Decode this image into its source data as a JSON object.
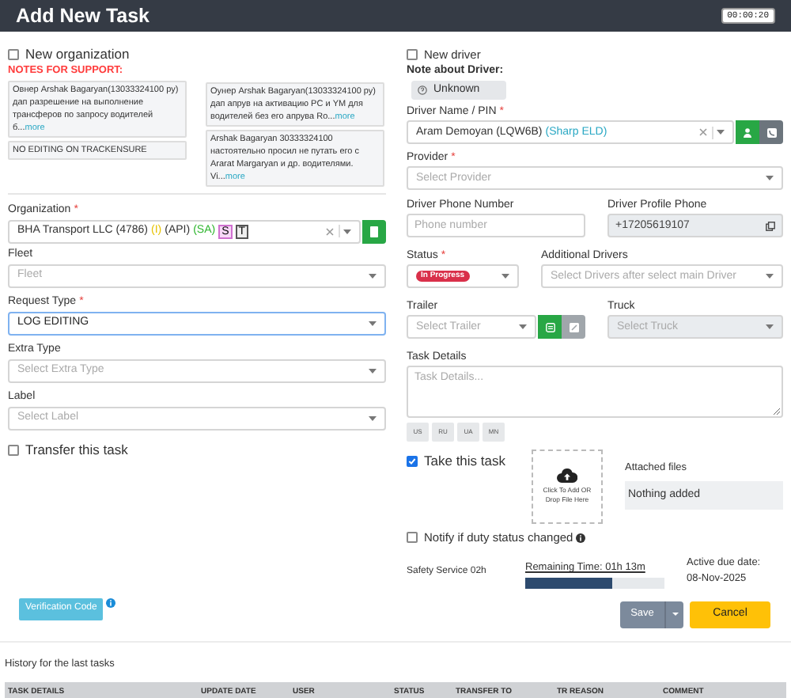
{
  "window": {
    "title": "Add New Task",
    "timer": "00:00:20"
  },
  "new_organization": {
    "label": "New organization",
    "checked": false
  },
  "notes": {
    "title": "NOTES FOR SUPPORT:",
    "columns": [
      [
        {
          "text": "Овнер Arshak Bagaryan(13033324100 ру) дап разрешение на выполнение трансферов по запросу водителей б...",
          "more": "more"
        },
        {
          "text": "NO EDITING ON TRACKENSURE"
        }
      ],
      [
        {
          "text": "Оунер Arshak Bagaryan(13033324100 ру) дап апрув на активацию PC и YM для водителей без его апрува Ro...",
          "more": "more"
        },
        {
          "text": "Arshak Bagaryan 30333324100 настоятельно просил не путать его с Ararat Margaryan и др. водителями. Vi...",
          "more": "more"
        }
      ]
    ]
  },
  "organization": {
    "label": "Organization",
    "required_mark": "*",
    "value_parts": [
      {
        "kind": "text",
        "text": "BHA Transport LLC (4786)"
      },
      {
        "kind": "yellow",
        "text": "(I)"
      },
      {
        "kind": "text",
        "text": "(API)"
      },
      {
        "kind": "green",
        "text": "(SA)"
      },
      {
        "kind": "pink-tag",
        "text": "S"
      },
      {
        "kind": "tag",
        "text": "T"
      }
    ]
  },
  "fleet": {
    "label": "Fleet",
    "placeholder": "Fleet"
  },
  "request_type": {
    "label": "Request Type",
    "required_mark": "*",
    "value": "LOG EDITING",
    "focused": true
  },
  "extra_type": {
    "label": "Extra Type",
    "placeholder": "Select Extra Type"
  },
  "label_field": {
    "label": "Label",
    "placeholder": "Select Label"
  },
  "transfer": {
    "label": "Transfer this task",
    "checked": false
  },
  "verification_button": "Verification Code",
  "new_driver": {
    "label": "New driver",
    "checked": false
  },
  "driver_note": {
    "label": "Note about Driver:",
    "badge": "Unknown"
  },
  "driver": {
    "label": "Driver Name / PIN",
    "required_mark": "*",
    "value_parts": [
      {
        "kind": "text",
        "text": "Aram Demoyan (LQW6B)"
      },
      {
        "kind": "link",
        "text": "(Sharp ELD)"
      }
    ]
  },
  "provider": {
    "label": "Provider",
    "required_mark": "*",
    "placeholder": "Select Provider"
  },
  "driver_phone": {
    "label": "Driver Phone Number",
    "placeholder": "Phone number"
  },
  "profile_phone": {
    "label": "Driver Profile Phone",
    "value": "+17205619107"
  },
  "status": {
    "label": "Status",
    "required_mark": "*",
    "value": "In Progress"
  },
  "additional_drivers": {
    "label": "Additional Drivers",
    "placeholder": "Select Drivers after select main Driver"
  },
  "trailer": {
    "label": "Trailer",
    "placeholder": "Select Trailer"
  },
  "truck": {
    "label": "Truck",
    "placeholder": "Select Truck",
    "disabled": true
  },
  "task_details": {
    "label": "Task Details",
    "placeholder": "Task Details..."
  },
  "languages": [
    "US",
    "RU",
    "UA",
    "MN"
  ],
  "take_task": {
    "label": "Take this task",
    "checked": true
  },
  "upload": {
    "text": "Click To Add OR Drop File Here"
  },
  "attached_files": {
    "label": "Attached files",
    "value": "Nothing added"
  },
  "notify": {
    "label": "Notify if duty status changed",
    "checked": false
  },
  "safety_service": "Safety Service 02h",
  "remaining": {
    "label": "Remaining Time: 01h 13m",
    "level": 0.62
  },
  "due_date": {
    "label": "Active due date:",
    "value": "08-Nov-2025"
  },
  "actions": {
    "save": "Save",
    "cancel": "Cancel"
  },
  "history": {
    "title": "History for the last tasks",
    "columns": [
      "TASK DETAILS",
      "UPDATE DATE",
      "USER",
      "STATUS",
      "TRANSFER TO",
      "TR REASON",
      "COMMENT"
    ]
  }
}
